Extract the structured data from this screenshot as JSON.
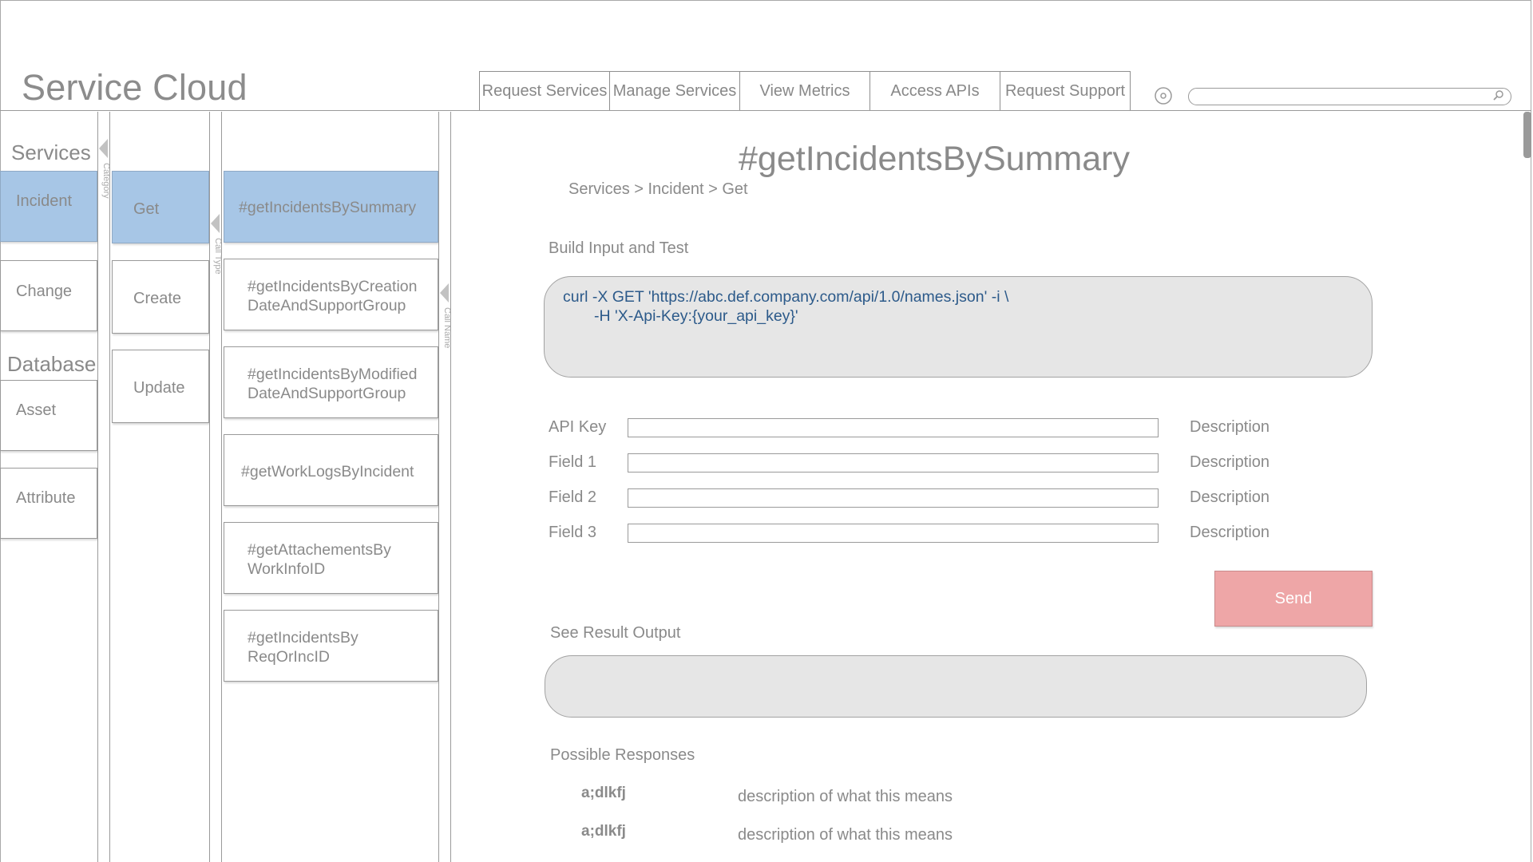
{
  "app": {
    "title": "Service Cloud"
  },
  "nav": {
    "tabs": [
      {
        "label": "Request Services"
      },
      {
        "label": "Manage Services"
      },
      {
        "label": "View Metrics"
      },
      {
        "label": "Access APIs"
      },
      {
        "label": "Request Support"
      }
    ],
    "search_placeholder": ""
  },
  "sidebar": {
    "services_heading": "Services",
    "database_heading": "Database",
    "services": [
      {
        "label": "Incident",
        "active": true
      },
      {
        "label": "Change",
        "active": false
      }
    ],
    "database": [
      {
        "label": "Asset"
      },
      {
        "label": "Attribute"
      }
    ],
    "category_label": "Category",
    "call_type_label": "Call Type",
    "call_name_label": "Call Name",
    "call_types": [
      {
        "label": "Get",
        "active": true
      },
      {
        "label": "Create",
        "active": false
      },
      {
        "label": "Update",
        "active": false
      }
    ],
    "calls": [
      {
        "line1": "#getIncidentsBySummary",
        "line2": "",
        "active": true
      },
      {
        "line1": "#getIncidentsByCreation",
        "line2": "DateAndSupportGroup",
        "active": false
      },
      {
        "line1": "#getIncidentsByModified",
        "line2": "DateAndSupportGroup",
        "active": false
      },
      {
        "line1": "#getWorkLogsByIncident",
        "line2": "",
        "active": false
      },
      {
        "line1": "#getAttachementsBy",
        "line2": "WorkInfoID",
        "active": false
      },
      {
        "line1": "#getIncidentsBy",
        "line2": "ReqOrIncID",
        "active": false
      }
    ]
  },
  "main": {
    "title": "#getIncidentsBySummary",
    "breadcrumb": "Services > Incident > Get",
    "build_label": "Build Input and Test",
    "code": {
      "line1": "curl -X GET 'https://abc.def.company.com/api/1.0/names.json' -i \\",
      "line2": "-H 'X-Api-Key:{your_api_key}'"
    },
    "fields": [
      {
        "label": "API Key",
        "value": "",
        "description": "Description"
      },
      {
        "label": "Field 1",
        "value": "",
        "description": "Description"
      },
      {
        "label": "Field 2",
        "value": "",
        "description": "Description"
      },
      {
        "label": "Field 3",
        "value": "",
        "description": "Description"
      }
    ],
    "send_label": "Send",
    "result_label": "See Result Output",
    "result_value": "",
    "responses_label": "Possible Responses",
    "responses": [
      {
        "code": "a;dlkfj",
        "description": "description of what this means"
      },
      {
        "code": "a;dlkfj",
        "description": "description of what this means"
      }
    ]
  },
  "colors": {
    "active_nav": "#a7c6e6",
    "send_button": "#eea6a7",
    "code_text": "#2c5a8a",
    "box_fill": "#e6e6e6"
  },
  "icons": [
    "settings-icon",
    "search-icon",
    "collapse-arrow-icon"
  ]
}
